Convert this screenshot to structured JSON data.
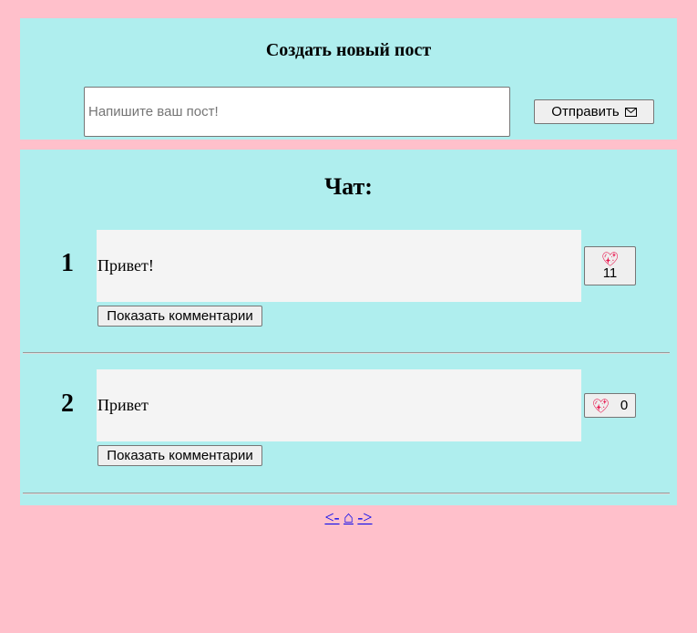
{
  "create": {
    "title": "Создать новый пост",
    "input_placeholder": "Напишите ваш пост!",
    "send_label": "Отправить"
  },
  "chat": {
    "title": "Чат:",
    "posts": [
      {
        "number": "1",
        "text": "Привет!",
        "likes": "11",
        "comments_label": "Показать комментарии"
      },
      {
        "number": "2",
        "text": "Привет",
        "likes": "0",
        "comments_label": "Показать комментарии"
      }
    ]
  },
  "nav": {
    "prev": "<-",
    "home": "⌂",
    "next": "->"
  },
  "colors": {
    "page_bg": "#ffc0cb",
    "panel_bg": "#afeeee",
    "message_bg": "#f4f4f4",
    "heart": "#e8184f"
  },
  "icons": {
    "send": "envelope-icon",
    "like": "heart-icon"
  }
}
